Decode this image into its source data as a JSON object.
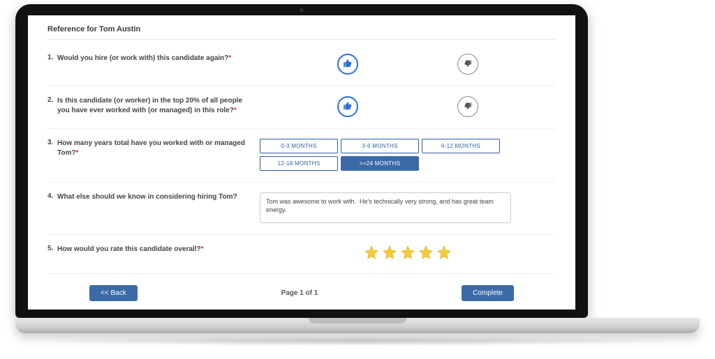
{
  "page_title": "Reference for Tom Austin",
  "questions": {
    "q1": {
      "num": "1.",
      "text": "Would you hire (or work with) this candidate again?",
      "required": true
    },
    "q2": {
      "num": "2.",
      "text": "Is this candidate (or worker) in the top 20% of all people you have ever worked with (or managed) in this role?",
      "required": true
    },
    "q3": {
      "num": "3.",
      "text": "How many years total have you worked with or managed Tom?",
      "required": true
    },
    "q4": {
      "num": "4.",
      "text": "What else should we know in considering hiring Tom?",
      "required": false
    },
    "q5": {
      "num": "5.",
      "text": "How would you rate this candidate overall?",
      "required": true
    }
  },
  "duration_options": {
    "o1": "0-3 MONTHS",
    "o2": "3-6 MONTHS",
    "o3": "6-12 MONTHS",
    "o4": "12-18 MONTHS",
    "o5": ">=24 MONTHS"
  },
  "q3_selected_index": 4,
  "q4_value": "Tom was awesome to work with.  He's technically very strong, and has great team energy.",
  "q5_rating": 5,
  "footer": {
    "back_label": "<< Back",
    "pager": "Page 1 of 1",
    "complete_label": "Complete"
  },
  "required_marker": "*"
}
